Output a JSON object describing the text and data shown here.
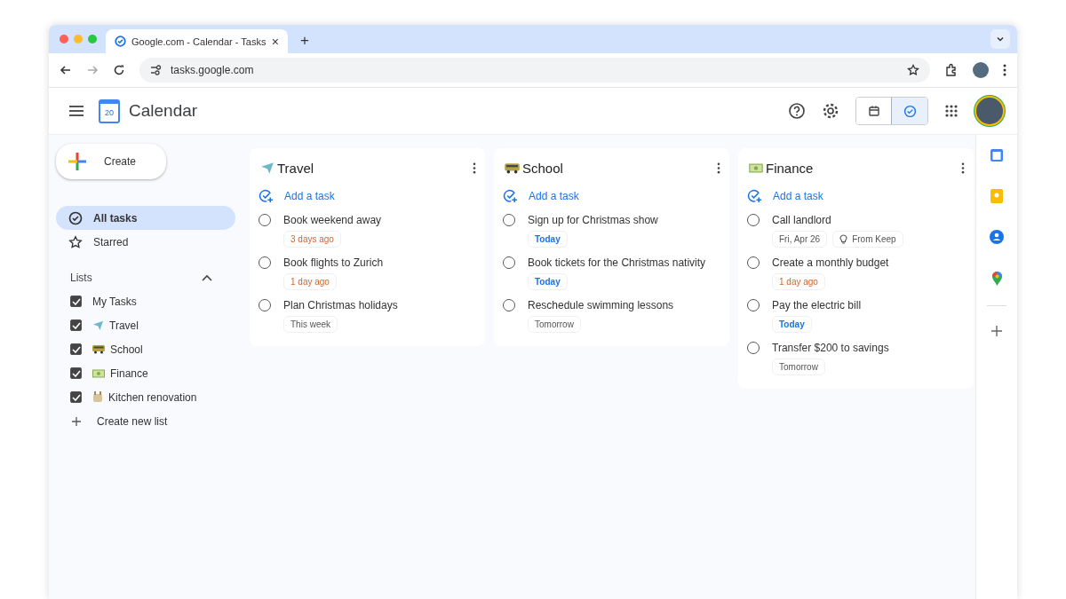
{
  "browser": {
    "tab_title": "Google.com - Calendar - Tasks",
    "tab_close": "×",
    "new_tab": "+",
    "address": "tasks.google.com"
  },
  "app": {
    "title": "Calendar",
    "logo_text": "20",
    "views": [
      {
        "kind": "calendar",
        "selected": false
      },
      {
        "kind": "tasks",
        "selected": true
      }
    ]
  },
  "sidebar": {
    "create_label": "Create",
    "nav": [
      {
        "kind": "all",
        "label": "All tasks",
        "selected": true
      },
      {
        "kind": "star",
        "label": "Starred",
        "selected": false
      }
    ],
    "lists_heading": "Lists",
    "lists_expanded": true,
    "lists": [
      {
        "label": "My Tasks",
        "kind": "none",
        "checked": true
      },
      {
        "label": "Travel",
        "kind": "plane",
        "checked": true
      },
      {
        "label": "School",
        "kind": "bus",
        "checked": true
      },
      {
        "label": "Finance",
        "kind": "money",
        "checked": true
      },
      {
        "label": "Kitchen renovation",
        "kind": "tools",
        "checked": true
      }
    ],
    "create_list": "Create new list"
  },
  "columns": [
    {
      "title": "Travel",
      "kind": "plane",
      "add_label": "Add a task",
      "tasks": [
        {
          "title": "Book weekend away",
          "completed": false,
          "tags": [
            {
              "text": "3 days ago",
              "kind": "overdue"
            }
          ]
        },
        {
          "title": "Book flights to Zurich",
          "completed": false,
          "tags": [
            {
              "text": "1 day ago",
              "kind": "overdue"
            }
          ]
        },
        {
          "title": "Plan Christmas holidays",
          "completed": false,
          "tags": [
            {
              "text": "This week",
              "kind": "plain"
            }
          ]
        }
      ]
    },
    {
      "title": "School",
      "kind": "bus",
      "add_label": "Add a task",
      "tasks": [
        {
          "title": "Sign up for Christmas show",
          "completed": false,
          "tags": [
            {
              "text": "Today",
              "kind": "today"
            }
          ]
        },
        {
          "title": "Book tickets for the Christmas nativity",
          "completed": false,
          "tags": [
            {
              "text": "Today",
              "kind": "today"
            }
          ]
        },
        {
          "title": "Reschedule swimming lessons",
          "completed": false,
          "tags": [
            {
              "text": "Tomorrow",
              "kind": "plain"
            }
          ]
        }
      ]
    },
    {
      "title": "Finance",
      "kind": "money",
      "add_label": "Add a task",
      "tasks": [
        {
          "title": "Call landlord",
          "completed": false,
          "tags": [
            {
              "text": "Fri, Apr 26",
              "kind": "plain"
            },
            {
              "text": "From Keep",
              "kind": "keep"
            }
          ]
        },
        {
          "title": "Create a monthly budget",
          "completed": false,
          "tags": [
            {
              "text": "1 day ago",
              "kind": "overdue"
            }
          ]
        },
        {
          "title": "Pay the electric bill",
          "completed": false,
          "tags": [
            {
              "text": "Today",
              "kind": "today"
            }
          ]
        },
        {
          "title": "Transfer $200 to savings",
          "completed": false,
          "tags": [
            {
              "text": "Tomorrow",
              "kind": "plain"
            }
          ]
        }
      ]
    }
  ],
  "side_panel": [
    {
      "kind": "calendar"
    },
    {
      "kind": "keep"
    },
    {
      "kind": "contacts"
    },
    {
      "kind": "maps"
    },
    {
      "kind": "add"
    }
  ]
}
